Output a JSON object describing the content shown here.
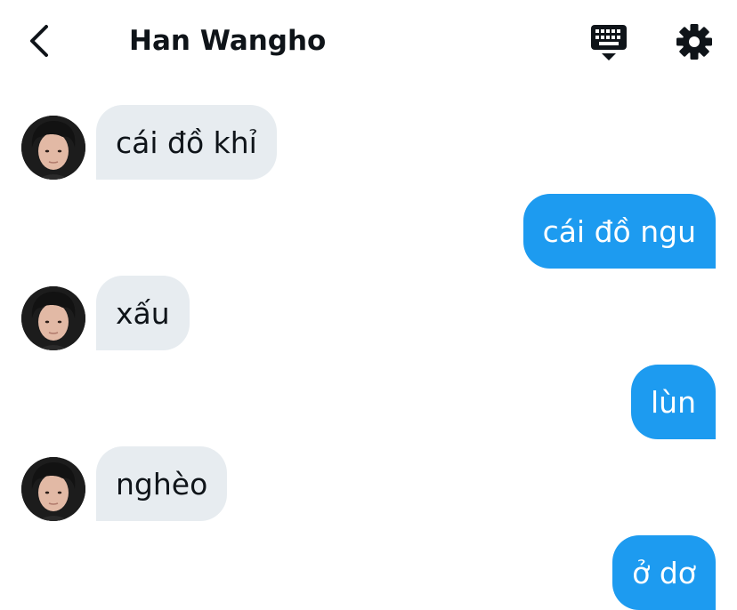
{
  "header": {
    "title": "Han Wangho",
    "back_icon": "chevron-left-icon",
    "keyboard_icon": "keyboard-icon",
    "settings_icon": "gear-icon"
  },
  "colors": {
    "incoming_bubble": "#e7ecf0",
    "outgoing_bubble": "#1d9bf0",
    "text_dark": "#0f1419"
  },
  "messages": [
    {
      "direction": "incoming",
      "text": "cái đồ khỉ"
    },
    {
      "direction": "outgoing",
      "text": "cái đồ ngu"
    },
    {
      "direction": "incoming",
      "text": "xấu"
    },
    {
      "direction": "outgoing",
      "text": "lùn"
    },
    {
      "direction": "incoming",
      "text": "nghèo"
    },
    {
      "direction": "outgoing",
      "text": "ở dơ"
    }
  ]
}
